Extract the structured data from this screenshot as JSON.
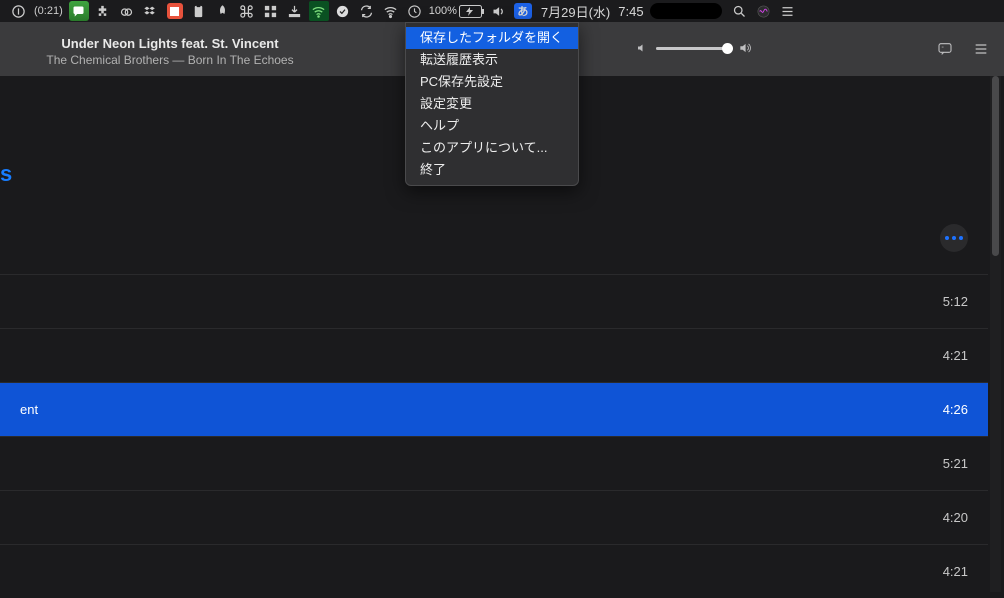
{
  "menubar": {
    "timer_label": "(0:21)",
    "battery_pct": "100%",
    "jp_input": "あ",
    "date": "7月29日(水)",
    "time": "7:45"
  },
  "dropdown": {
    "items": [
      "保存したフォルダを開く",
      "転送履歴表示",
      "PC保存先設定",
      "設定変更",
      "ヘルプ",
      "このアプリについて...",
      "終了"
    ]
  },
  "now_playing": {
    "title": "Under Neon Lights feat. St. Vincent",
    "subtitle": "The Chemical Brothers — Born In The Echoes"
  },
  "partial_header_text": "s",
  "tracks": [
    {
      "title": "",
      "dur": "5:12",
      "selected": false
    },
    {
      "title": "",
      "dur": "4:21",
      "selected": false
    },
    {
      "title": "ent",
      "dur": "4:26",
      "selected": true
    },
    {
      "title": "",
      "dur": "5:21",
      "selected": false
    },
    {
      "title": "",
      "dur": "4:20",
      "selected": false
    },
    {
      "title": "",
      "dur": "4:21",
      "selected": false
    }
  ]
}
